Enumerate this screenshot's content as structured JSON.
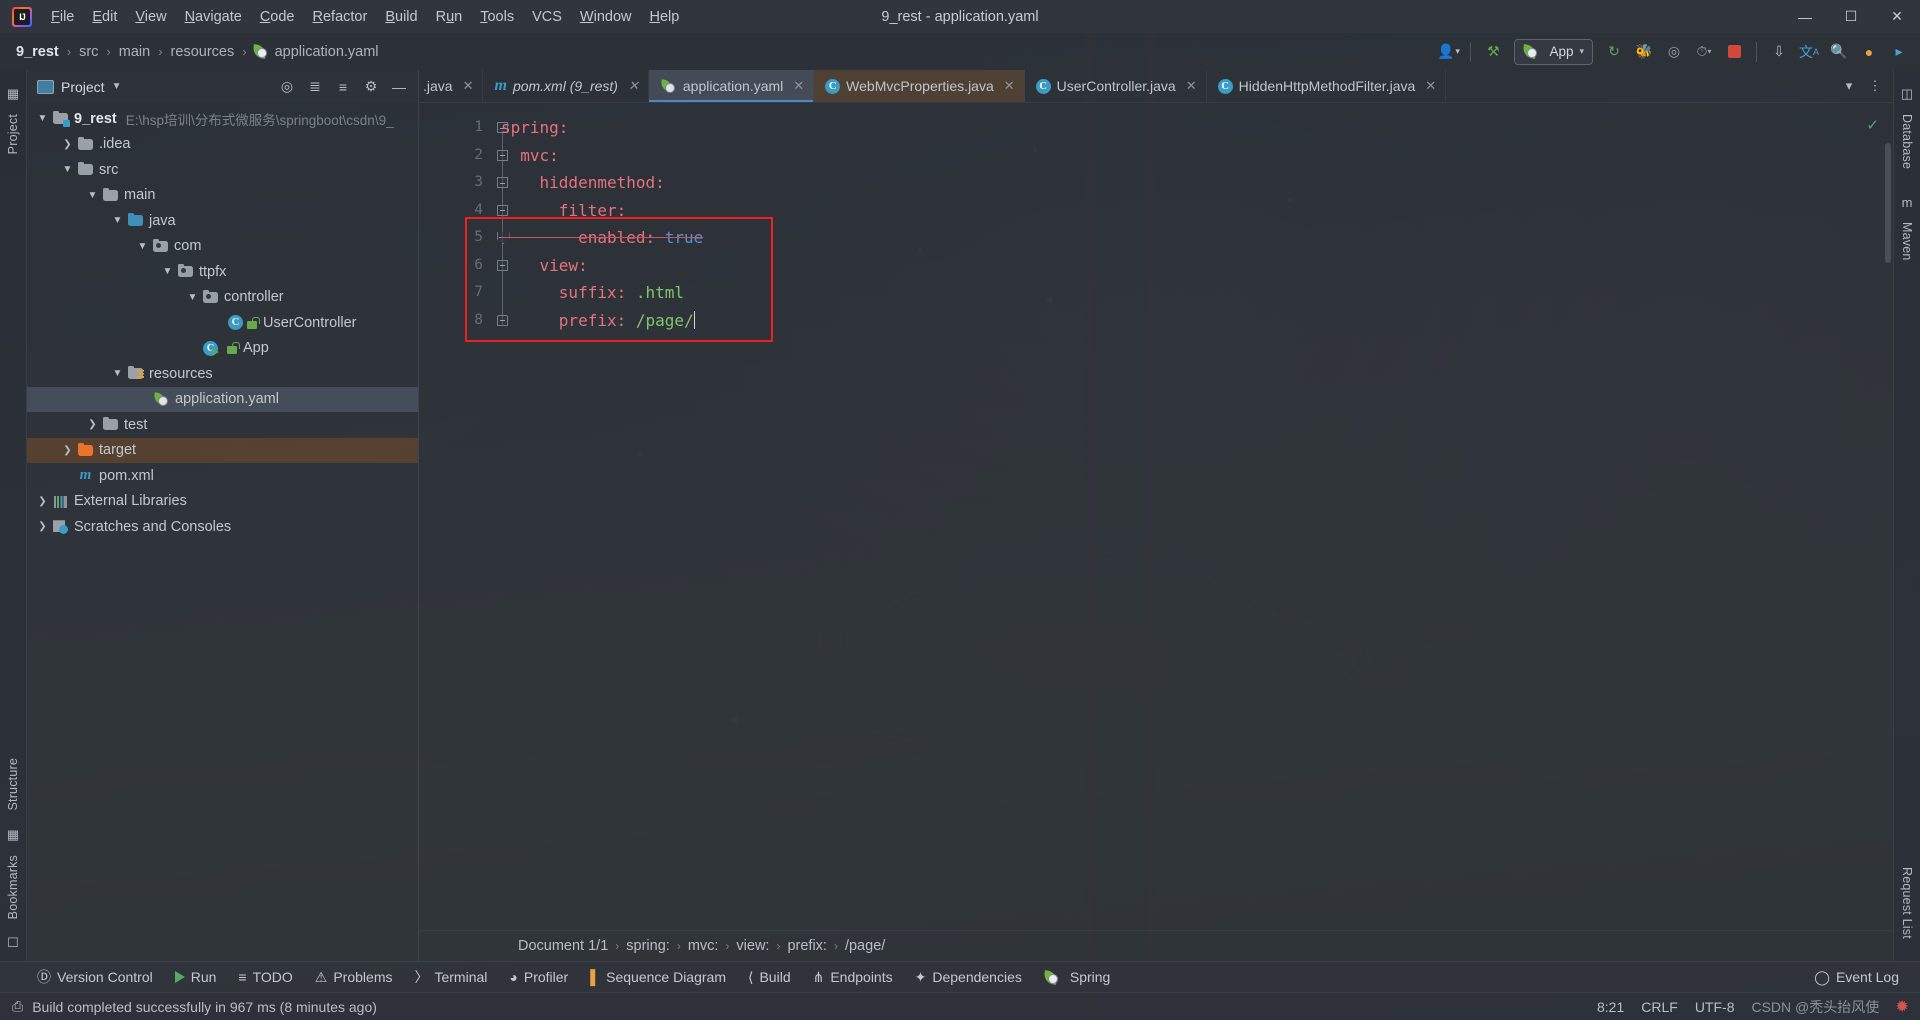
{
  "window": {
    "title": "9_rest - application.yaml",
    "minimize_label": "—",
    "maximize_label": "❐",
    "close_label": "✕"
  },
  "menu": {
    "items": [
      {
        "label": "File",
        "mnemonic": "F"
      },
      {
        "label": "Edit",
        "mnemonic": "E"
      },
      {
        "label": "View",
        "mnemonic": "V"
      },
      {
        "label": "Navigate",
        "mnemonic": "N"
      },
      {
        "label": "Code",
        "mnemonic": "C"
      },
      {
        "label": "Refactor",
        "mnemonic": "R"
      },
      {
        "label": "Build",
        "mnemonic": "B"
      },
      {
        "label": "Run",
        "mnemonic": "u"
      },
      {
        "label": "Tools",
        "mnemonic": "T"
      },
      {
        "label": "VCS",
        "mnemonic": ""
      },
      {
        "label": "Window",
        "mnemonic": "W"
      },
      {
        "label": "Help",
        "mnemonic": "H"
      }
    ]
  },
  "navbar": {
    "breadcrumbs": [
      "9_rest",
      "src",
      "main",
      "resources",
      "application.yaml"
    ],
    "separator": "›",
    "run_config": "App",
    "icons": [
      "user-avatar-icon",
      "hammer-icon",
      "rerun-icon",
      "debug-icon",
      "coverage-icon",
      "profile-icon",
      "stop-icon",
      "update-icon",
      "translate-icon",
      "search-icon",
      "account-icon",
      "plugin-icon"
    ]
  },
  "left_strip": {
    "top": "Project",
    "bottom": [
      "Structure",
      "Bookmarks"
    ]
  },
  "right_strip": {
    "items": [
      "Database",
      "Maven",
      "Request List"
    ]
  },
  "project_pane": {
    "title": "Project",
    "header_icons": [
      "locate-icon",
      "expand-all-icon",
      "collapse-all-icon",
      "settings-icon",
      "hide-icon"
    ],
    "tree": [
      {
        "label": "9_rest",
        "path": "E:\\hsp培训\\分布式微服务\\springboot\\csdn\\9_",
        "indent": 0,
        "arrow": "⌄",
        "icon": "module-folder-icon",
        "bold": true,
        "selected": "none"
      },
      {
        "label": ".idea",
        "path": "",
        "indent": 1,
        "arrow": "›",
        "icon": "folder-icon",
        "bold": false,
        "selected": "none"
      },
      {
        "label": "src",
        "path": "",
        "indent": 1,
        "arrow": "⌄",
        "icon": "folder-icon",
        "bold": false,
        "selected": "none"
      },
      {
        "label": "main",
        "path": "",
        "indent": 2,
        "arrow": "⌄",
        "icon": "folder-icon",
        "bold": false,
        "selected": "none"
      },
      {
        "label": "java",
        "path": "",
        "indent": 3,
        "arrow": "⌄",
        "icon": "source-folder-icon",
        "bold": false,
        "selected": "none"
      },
      {
        "label": "com",
        "path": "",
        "indent": 4,
        "arrow": "⌄",
        "icon": "package-icon",
        "bold": false,
        "selected": "none"
      },
      {
        "label": "ttpfx",
        "path": "",
        "indent": 5,
        "arrow": "⌄",
        "icon": "package-icon",
        "bold": false,
        "selected": "none"
      },
      {
        "label": "controller",
        "path": "",
        "indent": 6,
        "arrow": "⌄",
        "icon": "package-icon",
        "bold": false,
        "selected": "none"
      },
      {
        "label": "UserController",
        "path": "",
        "indent": 7,
        "arrow": "",
        "icon": "java-class-icon",
        "bold": false,
        "selected": "none"
      },
      {
        "label": "App",
        "path": "",
        "indent": 6,
        "arrow": "",
        "icon": "spring-boot-class-icon",
        "bold": false,
        "selected": "none"
      },
      {
        "label": "resources",
        "path": "",
        "indent": 3,
        "arrow": "⌄",
        "icon": "resources-folder-icon",
        "bold": false,
        "selected": "none"
      },
      {
        "label": "application.yaml",
        "path": "",
        "indent": 4,
        "arrow": "",
        "icon": "yaml-spring-icon",
        "bold": false,
        "selected": "blue"
      },
      {
        "label": "test",
        "path": "",
        "indent": 2,
        "arrow": "›",
        "icon": "folder-icon",
        "bold": false,
        "selected": "none"
      },
      {
        "label": "target",
        "path": "",
        "indent": 1,
        "arrow": "›",
        "icon": "target-folder-icon",
        "bold": false,
        "selected": "brown"
      },
      {
        "label": "pom.xml",
        "path": "",
        "indent": 1,
        "arrow": "",
        "icon": "maven-icon",
        "bold": false,
        "selected": "none"
      },
      {
        "label": "External Libraries",
        "path": "",
        "indent": 0,
        "arrow": "›",
        "icon": "libraries-icon",
        "bold": false,
        "selected": "none"
      },
      {
        "label": "Scratches and Consoles",
        "path": "",
        "indent": 0,
        "arrow": "›",
        "icon": "scratches-icon",
        "bold": false,
        "selected": "none"
      }
    ]
  },
  "editor": {
    "tabs": [
      {
        "label": ".java",
        "icon": "none",
        "state": "clipped",
        "closable": true
      },
      {
        "label": "pom.xml (9_rest)",
        "icon": "maven-icon",
        "state": "italic",
        "closable": true
      },
      {
        "label": "application.yaml",
        "icon": "yaml-spring-icon",
        "state": "active",
        "closable": true
      },
      {
        "label": "WebMvcProperties.java",
        "icon": "java-class-icon",
        "state": "orange",
        "closable": true
      },
      {
        "label": "UserController.java",
        "icon": "java-class-icon",
        "state": "normal",
        "closable": true
      },
      {
        "label": "HiddenHttpMethodFilter.java",
        "icon": "java-class-icon",
        "state": "normal",
        "closable": true
      }
    ],
    "tab_overflow_icon": "chevron-down-icon",
    "tab_options_icon": "more-options-icon",
    "inspection_status": "✓",
    "lines": [
      {
        "n": 1,
        "indent": 0,
        "key": "spring",
        "value": "",
        "value_type": "none",
        "fold": "box",
        "strike": false
      },
      {
        "n": 2,
        "indent": 1,
        "key": "mvc",
        "value": "",
        "value_type": "none",
        "fold": "box",
        "strike": false
      },
      {
        "n": 3,
        "indent": 2,
        "key": "hiddenmethod",
        "value": "",
        "value_type": "none",
        "fold": "box",
        "strike": false
      },
      {
        "n": 4,
        "indent": 3,
        "key": "filter",
        "value": "",
        "value_type": "none",
        "fold": "box",
        "strike": false
      },
      {
        "n": 5,
        "indent": 4,
        "key": "enabled",
        "value": "true",
        "value_type": "bool",
        "fold": "arrow",
        "strike": true
      },
      {
        "n": 6,
        "indent": 2,
        "key": "view",
        "value": "",
        "value_type": "none",
        "fold": "box",
        "strike": false
      },
      {
        "n": 7,
        "indent": 3,
        "key": "suffix",
        "value": ".html",
        "value_type": "string",
        "fold": "none",
        "strike": false
      },
      {
        "n": 8,
        "indent": 3,
        "key": "prefix",
        "value": "/page/",
        "value_type": "string",
        "fold": "lock",
        "strike": false
      }
    ],
    "highlight_box": "red-annotation-rectangle"
  },
  "doc_breadcrumbs": {
    "items": [
      "Document 1/1",
      "spring:",
      "mvc:",
      "view:",
      "prefix:",
      "/page/"
    ],
    "separator": "›"
  },
  "bottom_toolbar": {
    "items": [
      {
        "label": "Version Control",
        "icon": "branch-icon"
      },
      {
        "label": "Run",
        "icon": "run-icon"
      },
      {
        "label": "TODO",
        "icon": "todo-icon"
      },
      {
        "label": "Problems",
        "icon": "problems-icon"
      },
      {
        "label": "Terminal",
        "icon": "terminal-icon"
      },
      {
        "label": "Profiler",
        "icon": "profiler-icon"
      },
      {
        "label": "Sequence Diagram",
        "icon": "sequence-diagram-icon"
      },
      {
        "label": "Build",
        "icon": "build-icon"
      },
      {
        "label": "Endpoints",
        "icon": "endpoints-icon"
      },
      {
        "label": "Dependencies",
        "icon": "dependencies-icon"
      },
      {
        "label": "Spring",
        "icon": "spring-leaf-icon"
      }
    ],
    "right": {
      "label": "Event Log",
      "icon": "event-log-icon"
    }
  },
  "statusbar": {
    "message": "Build completed successfully in 967 ms (8 minutes ago)",
    "message_icon": "build-status-icon",
    "caret_position": "8:21",
    "line_separator": "CRLF",
    "encoding": "UTF-8",
    "watermark": "CSDN @秃头抬风使"
  }
}
